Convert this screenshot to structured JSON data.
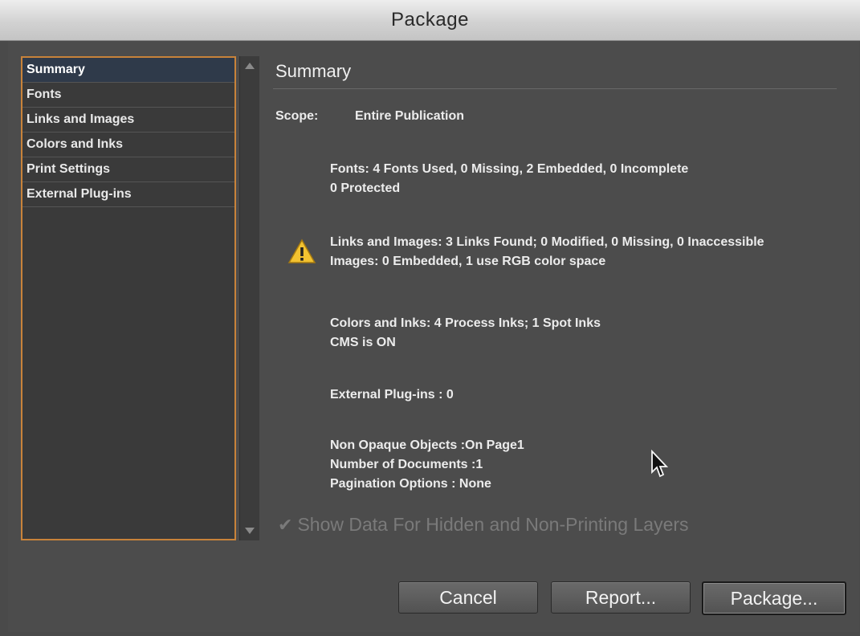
{
  "window": {
    "title": "Package"
  },
  "sidebar": {
    "items": [
      {
        "label": "Summary"
      },
      {
        "label": "Fonts"
      },
      {
        "label": "Links and Images"
      },
      {
        "label": "Colors and Inks"
      },
      {
        "label": "Print Settings"
      },
      {
        "label": "External Plug-ins"
      }
    ],
    "selected": "Summary"
  },
  "summary": {
    "heading": "Summary",
    "scope_label": "Scope:",
    "scope_value": "Entire Publication",
    "fonts": {
      "line1": "Fonts: 4 Fonts Used, 0 Missing, 2 Embedded, 0 Incomplete",
      "line2": "0 Protected"
    },
    "links": {
      "line1": "Links and Images: 3 Links Found; 0 Modified, 0 Missing, 0 Inaccessible",
      "line2": "Images: 0 Embedded, 1 use RGB color space"
    },
    "colors": {
      "line1": "Colors and Inks: 4 Process Inks; 1 Spot Inks",
      "line2": "CMS is ON"
    },
    "plugins": {
      "line1": "External Plug-ins : 0"
    },
    "other": {
      "line1": "Non Opaque Objects :On Page1",
      "line2": "Number of Documents :1",
      "line3": "Pagination Options : None"
    },
    "warning_icon": "warning-triangle-icon"
  },
  "options": {
    "show_hidden_label": "Show Data For Hidden and Non-Printing Layers",
    "show_hidden_checked": true,
    "show_hidden_disabled": true
  },
  "buttons": {
    "cancel": "Cancel",
    "report": "Report...",
    "package": "Package..."
  },
  "colors": {
    "accent_border": "#c8833a",
    "warning": "#f2c230"
  }
}
